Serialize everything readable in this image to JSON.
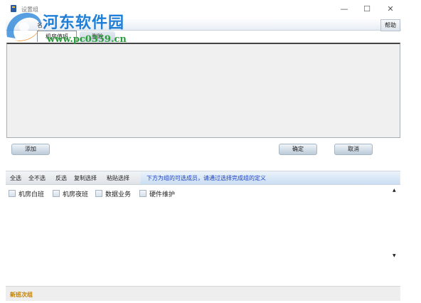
{
  "window": {
    "title": "设置组",
    "minimize_glyph": "—",
    "maximize_glyph": "☐",
    "close_glyph": "✕"
  },
  "watermark": {
    "title": "河东软件园",
    "url": "www.pc0359.cn"
  },
  "toolbar": {
    "label": "名",
    "help_label": "帮助"
  },
  "tabs": {
    "selected_label": "机房值班",
    "delete_label": "删除"
  },
  "buttons": {
    "add": "添加",
    "ok": "确定",
    "cancel": "取消"
  },
  "selection_toolbar": {
    "select_all": "全选",
    "select_none": "全不选",
    "invert": "反选",
    "copy_selection": "复制选择",
    "paste_selection": "粘贴选择",
    "hint": "下方为组的可选成员，请通过选择完成组的定义"
  },
  "groups": [
    {
      "label": "机房白班"
    },
    {
      "label": "机房夜班"
    },
    {
      "label": "数据业务"
    },
    {
      "label": "硬件维护"
    }
  ],
  "status": {
    "text": "新班次组"
  },
  "colors": {
    "hint_text": "#1a3ec6",
    "status_text": "#c0820a",
    "watermark_title": "#1f7fd6",
    "watermark_url": "#2a9d3a"
  }
}
